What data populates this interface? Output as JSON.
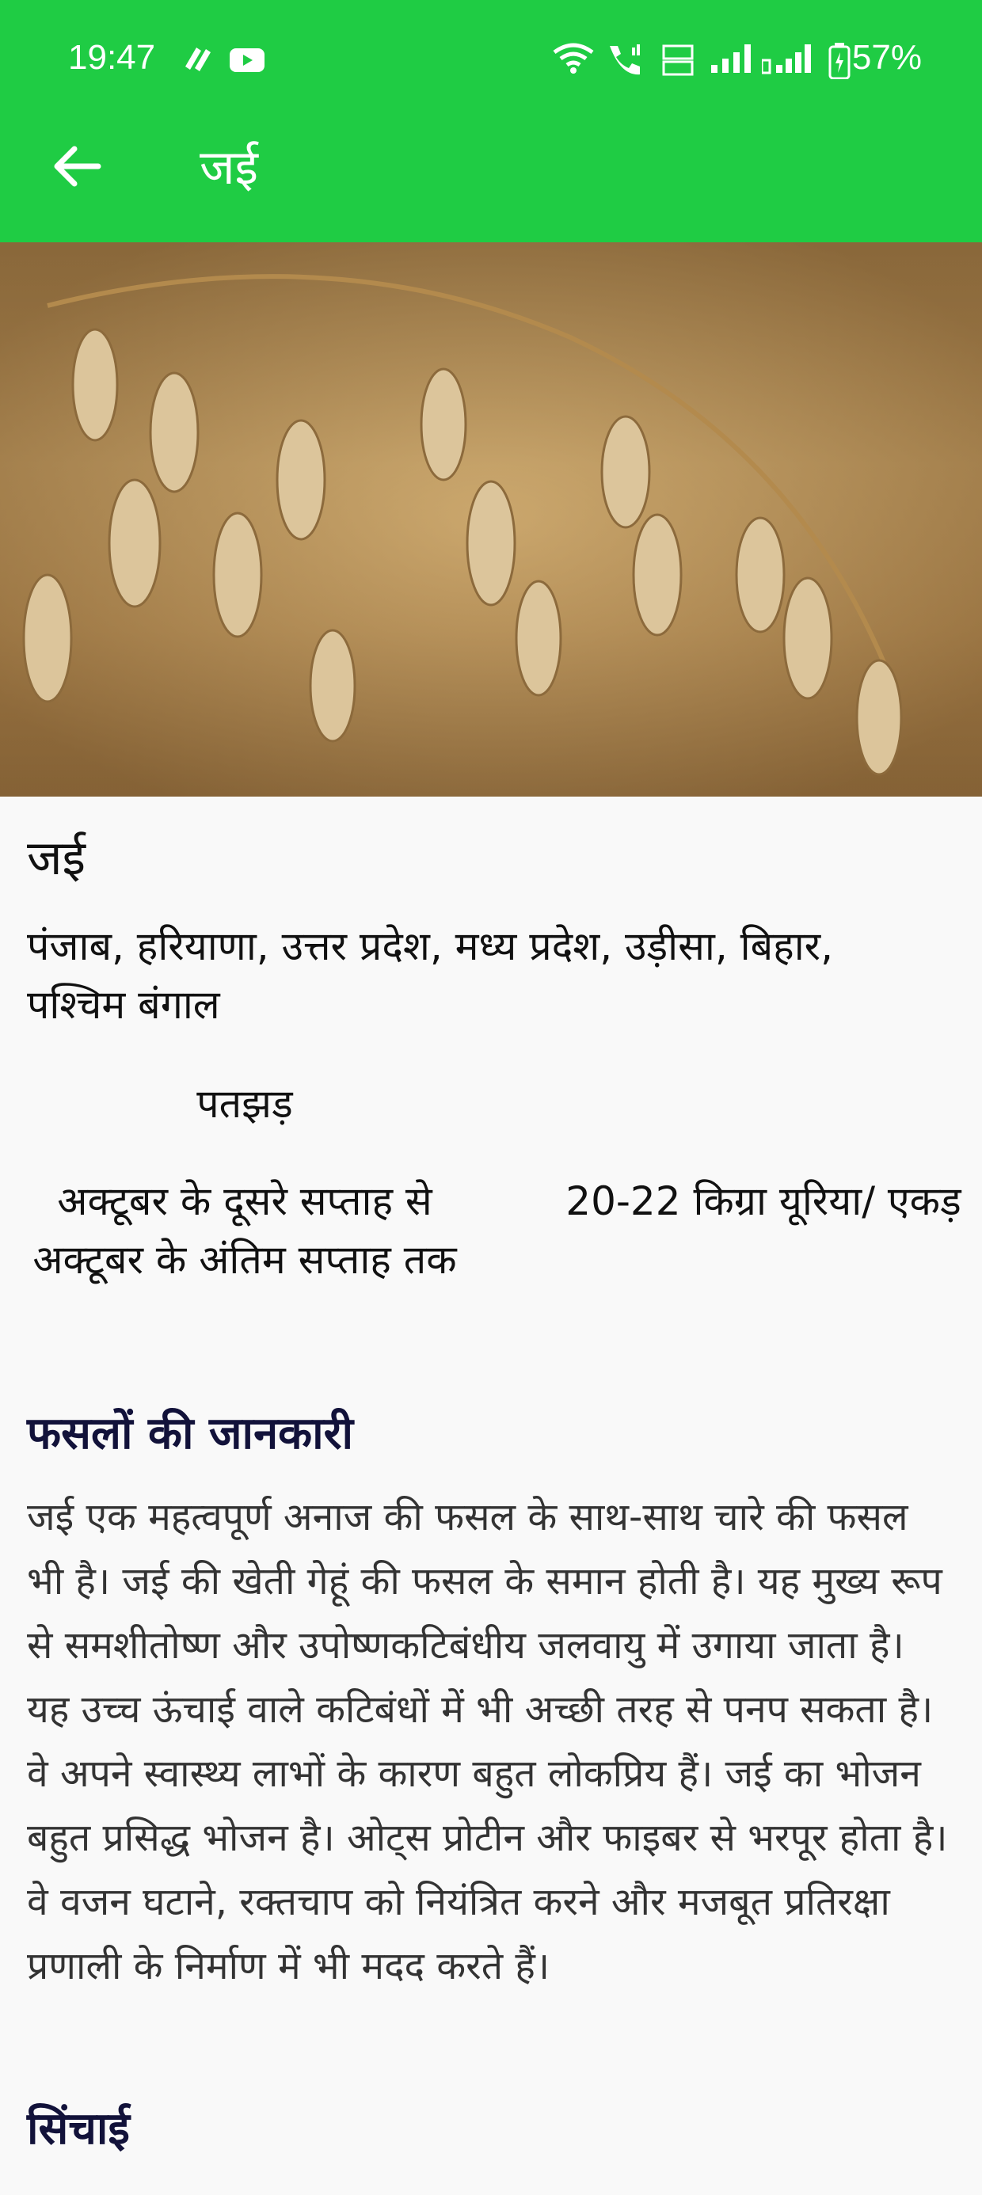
{
  "status_bar": {
    "time": "19:47",
    "battery": "57%"
  },
  "toolbar": {
    "title": "जई"
  },
  "crop": {
    "title": "जई",
    "regions": "पंजाब, हरियाणा, उत्तर प्रदेश, मध्य प्रदेश, उड़ीसा, बिहार, पश्चिम बंगाल",
    "season": "पतझड़",
    "sowing_time": "अक्टूबर के दूसरे सप्ताह से अक्टूबर के अंतिम सप्ताह तक",
    "fertilizer": "20-22 किग्रा यूरिया/ एकड़"
  },
  "info_section": {
    "title": "फसलों की जानकारी",
    "text": "जई एक महत्वपूर्ण अनाज की फसल के साथ-साथ चारे की फसल भी है। जई की खेती गेहूं की फसल के समान होती है। यह मुख्य रूप से समशीतोष्ण और उपोष्णकटिबंधीय जलवायु में उगाया जाता है। यह उच्च ऊंचाई वाले कटिबंधों में भी अच्छी तरह से पनप सकता है। वे अपने स्वास्थ्य लाभों के कारण बहुत लोकप्रिय हैं। जई का भोजन बहुत प्रसिद्ध भोजन है। ओट्स प्रोटीन और फाइबर से भरपूर होता है। वे वजन घटाने, रक्तचाप को नियंत्रित करने और मजबूत प्रतिरक्षा प्रणाली के निर्माण में भी मदद करते हैं।"
  },
  "irrigation_section": {
    "title": "सिंचाई"
  },
  "colors": {
    "appbar": "#1fcc44",
    "background": "#f9f9f9",
    "heading": "#12123a"
  },
  "icons": [
    "back-arrow-icon",
    "wifi-icon",
    "call-icon",
    "signal-icon",
    "battery-icon",
    "youtube-icon"
  ]
}
